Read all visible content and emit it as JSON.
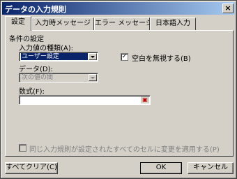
{
  "window": {
    "title": "データの入力規則",
    "close_label": "×"
  },
  "tabs": [
    {
      "label": "設定",
      "active": true
    },
    {
      "label": "入力時メッセージ",
      "active": false
    },
    {
      "label": "エラー メッセージ",
      "active": false
    },
    {
      "label": "日本語入力",
      "active": false
    }
  ],
  "settings": {
    "group_label": "条件の設定",
    "allow_label": "入力値の種類(A):",
    "allow_value": "ユーザー設定",
    "ignore_blank_label": "空白を無視する(B)",
    "ignore_blank_checked": true,
    "data_label": "データ(D):",
    "data_value": "次の値の間",
    "formula_label": "数式(F):",
    "formula_value": "",
    "apply_all_label": "同じ入力規則が設定されたすべてのセルに変更を適用する(P)",
    "apply_all_checked": false
  },
  "buttons": {
    "clear_all": "すべてクリア(C)",
    "ok": "OK",
    "cancel": "キャンセル"
  },
  "icons": {
    "close": "close-icon",
    "dropdown": "chevron-down-icon",
    "checkmark": "checkmark-icon",
    "ref_edit": "range-select-icon"
  },
  "colors": {
    "face": "#d4d0c8",
    "title_start": "#0a246a",
    "title_end": "#a6caf0",
    "selection": "#0a246a"
  }
}
